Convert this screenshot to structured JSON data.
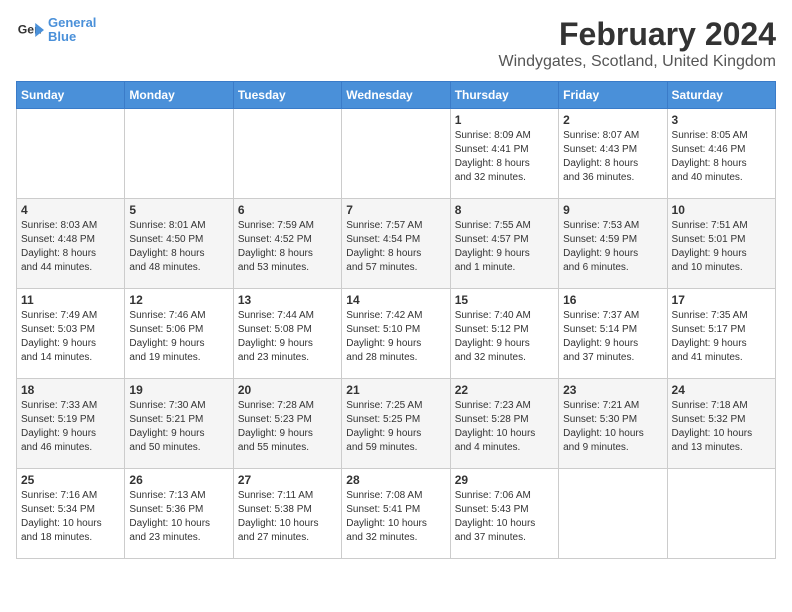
{
  "logo": {
    "line1": "General",
    "line2": "Blue",
    "icon": "▶"
  },
  "title": "February 2024",
  "subtitle": "Windygates, Scotland, United Kingdom",
  "weekdays": [
    "Sunday",
    "Monday",
    "Tuesday",
    "Wednesday",
    "Thursday",
    "Friday",
    "Saturday"
  ],
  "weeks": [
    [
      {
        "day": "",
        "info": ""
      },
      {
        "day": "",
        "info": ""
      },
      {
        "day": "",
        "info": ""
      },
      {
        "day": "",
        "info": ""
      },
      {
        "day": "1",
        "info": "Sunrise: 8:09 AM\nSunset: 4:41 PM\nDaylight: 8 hours\nand 32 minutes."
      },
      {
        "day": "2",
        "info": "Sunrise: 8:07 AM\nSunset: 4:43 PM\nDaylight: 8 hours\nand 36 minutes."
      },
      {
        "day": "3",
        "info": "Sunrise: 8:05 AM\nSunset: 4:46 PM\nDaylight: 8 hours\nand 40 minutes."
      }
    ],
    [
      {
        "day": "4",
        "info": "Sunrise: 8:03 AM\nSunset: 4:48 PM\nDaylight: 8 hours\nand 44 minutes."
      },
      {
        "day": "5",
        "info": "Sunrise: 8:01 AM\nSunset: 4:50 PM\nDaylight: 8 hours\nand 48 minutes."
      },
      {
        "day": "6",
        "info": "Sunrise: 7:59 AM\nSunset: 4:52 PM\nDaylight: 8 hours\nand 53 minutes."
      },
      {
        "day": "7",
        "info": "Sunrise: 7:57 AM\nSunset: 4:54 PM\nDaylight: 8 hours\nand 57 minutes."
      },
      {
        "day": "8",
        "info": "Sunrise: 7:55 AM\nSunset: 4:57 PM\nDaylight: 9 hours\nand 1 minute."
      },
      {
        "day": "9",
        "info": "Sunrise: 7:53 AM\nSunset: 4:59 PM\nDaylight: 9 hours\nand 6 minutes."
      },
      {
        "day": "10",
        "info": "Sunrise: 7:51 AM\nSunset: 5:01 PM\nDaylight: 9 hours\nand 10 minutes."
      }
    ],
    [
      {
        "day": "11",
        "info": "Sunrise: 7:49 AM\nSunset: 5:03 PM\nDaylight: 9 hours\nand 14 minutes."
      },
      {
        "day": "12",
        "info": "Sunrise: 7:46 AM\nSunset: 5:06 PM\nDaylight: 9 hours\nand 19 minutes."
      },
      {
        "day": "13",
        "info": "Sunrise: 7:44 AM\nSunset: 5:08 PM\nDaylight: 9 hours\nand 23 minutes."
      },
      {
        "day": "14",
        "info": "Sunrise: 7:42 AM\nSunset: 5:10 PM\nDaylight: 9 hours\nand 28 minutes."
      },
      {
        "day": "15",
        "info": "Sunrise: 7:40 AM\nSunset: 5:12 PM\nDaylight: 9 hours\nand 32 minutes."
      },
      {
        "day": "16",
        "info": "Sunrise: 7:37 AM\nSunset: 5:14 PM\nDaylight: 9 hours\nand 37 minutes."
      },
      {
        "day": "17",
        "info": "Sunrise: 7:35 AM\nSunset: 5:17 PM\nDaylight: 9 hours\nand 41 minutes."
      }
    ],
    [
      {
        "day": "18",
        "info": "Sunrise: 7:33 AM\nSunset: 5:19 PM\nDaylight: 9 hours\nand 46 minutes."
      },
      {
        "day": "19",
        "info": "Sunrise: 7:30 AM\nSunset: 5:21 PM\nDaylight: 9 hours\nand 50 minutes."
      },
      {
        "day": "20",
        "info": "Sunrise: 7:28 AM\nSunset: 5:23 PM\nDaylight: 9 hours\nand 55 minutes."
      },
      {
        "day": "21",
        "info": "Sunrise: 7:25 AM\nSunset: 5:25 PM\nDaylight: 9 hours\nand 59 minutes."
      },
      {
        "day": "22",
        "info": "Sunrise: 7:23 AM\nSunset: 5:28 PM\nDaylight: 10 hours\nand 4 minutes."
      },
      {
        "day": "23",
        "info": "Sunrise: 7:21 AM\nSunset: 5:30 PM\nDaylight: 10 hours\nand 9 minutes."
      },
      {
        "day": "24",
        "info": "Sunrise: 7:18 AM\nSunset: 5:32 PM\nDaylight: 10 hours\nand 13 minutes."
      }
    ],
    [
      {
        "day": "25",
        "info": "Sunrise: 7:16 AM\nSunset: 5:34 PM\nDaylight: 10 hours\nand 18 minutes."
      },
      {
        "day": "26",
        "info": "Sunrise: 7:13 AM\nSunset: 5:36 PM\nDaylight: 10 hours\nand 23 minutes."
      },
      {
        "day": "27",
        "info": "Sunrise: 7:11 AM\nSunset: 5:38 PM\nDaylight: 10 hours\nand 27 minutes."
      },
      {
        "day": "28",
        "info": "Sunrise: 7:08 AM\nSunset: 5:41 PM\nDaylight: 10 hours\nand 32 minutes."
      },
      {
        "day": "29",
        "info": "Sunrise: 7:06 AM\nSunset: 5:43 PM\nDaylight: 10 hours\nand 37 minutes."
      },
      {
        "day": "",
        "info": ""
      },
      {
        "day": "",
        "info": ""
      }
    ]
  ]
}
